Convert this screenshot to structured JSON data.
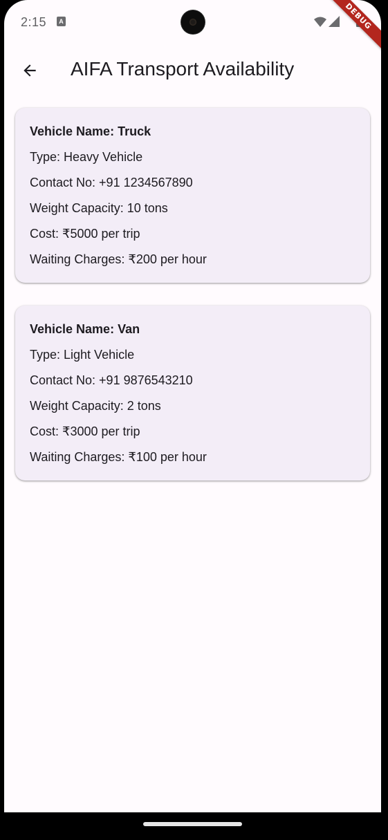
{
  "status_bar": {
    "time": "2:15",
    "notification_glyph": "A"
  },
  "debug_banner": {
    "label": "DEBUG"
  },
  "app_bar": {
    "back_icon": "arrow-back-icon",
    "title": "AIFA Transport Availability"
  },
  "vehicles": [
    {
      "name": "Vehicle Name: Truck",
      "type": "Type: Heavy Vehicle",
      "contact": "Contact No: +91 1234567890",
      "capacity": "Weight Capacity: 10 tons",
      "cost": "Cost: ₹5000 per trip",
      "waiting": "Waiting Charges: ₹200 per hour"
    },
    {
      "name": "Vehicle Name: Van",
      "type": "Type: Light Vehicle",
      "contact": "Contact No: +91 9876543210",
      "capacity": "Weight Capacity: 2 tons",
      "cost": "Cost: ₹3000 per trip",
      "waiting": "Waiting Charges: ₹100 per hour"
    }
  ],
  "colors": {
    "background": "#fffbfe",
    "card": "#f3edf7",
    "text": "#1d1b20",
    "debug_banner": "#b3261e"
  }
}
